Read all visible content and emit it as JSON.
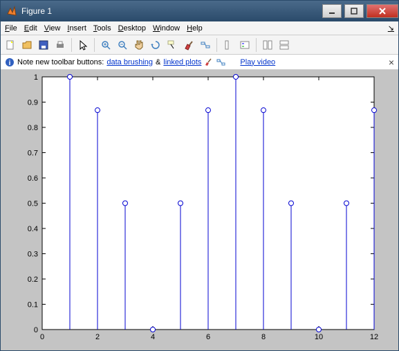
{
  "window": {
    "title": "Figure 1"
  },
  "menu": {
    "file": "File",
    "edit": "Edit",
    "view": "View",
    "insert": "Insert",
    "tools": "Tools",
    "desktop": "Desktop",
    "windowm": "Window",
    "help": "Help"
  },
  "note": {
    "prefix": "Note new toolbar buttons: ",
    "link1": "data brushing",
    "amp": " & ",
    "link2": "linked plots",
    "play": "Play video"
  },
  "chart_data": {
    "type": "stem",
    "x": [
      1,
      2,
      3,
      4,
      5,
      6,
      7,
      8,
      9,
      10,
      11,
      12
    ],
    "values": [
      1,
      0.868,
      0.5,
      0,
      0.5,
      0.868,
      1,
      0.868,
      0.5,
      0,
      0.5,
      0.868
    ],
    "xlim": [
      0,
      12
    ],
    "ylim": [
      0,
      1
    ],
    "xticks": [
      0,
      2,
      4,
      6,
      8,
      10,
      12
    ],
    "yticks": [
      0,
      0.1,
      0.2,
      0.3,
      0.4,
      0.5,
      0.6,
      0.7,
      0.8,
      0.9,
      1
    ],
    "color": "#0000d0"
  }
}
